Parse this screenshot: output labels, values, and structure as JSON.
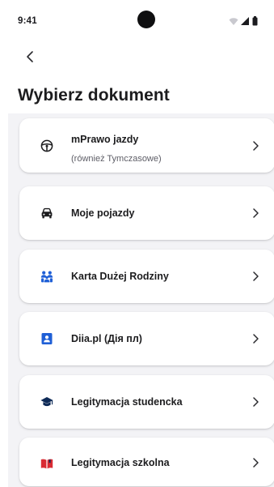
{
  "status_bar": {
    "time": "9:41"
  },
  "header": {
    "back_icon": "chevron-left-icon",
    "title": "Wybierz dokument"
  },
  "documents": [
    {
      "label": "mPrawo jazdy",
      "sublabel": "(również Tymczasowe)",
      "icon": "steering-wheel-icon"
    },
    {
      "label": "Moje pojazdy",
      "icon": "car-icon"
    },
    {
      "label": "Karta Dużej Rodziny",
      "icon": "family-icon"
    },
    {
      "label": "Diia.pl (Дія пл)",
      "icon": "id-card-icon"
    },
    {
      "label": "Legitymacja studencka",
      "icon": "graduation-cap-icon"
    },
    {
      "label": "Legitymacja szkolna",
      "icon": "book-icon"
    }
  ],
  "colors": {
    "accent_blue": "#1f5fd6",
    "navy": "#0e2a57",
    "red": "#d92b33",
    "list_background": "#f3f3f6"
  }
}
